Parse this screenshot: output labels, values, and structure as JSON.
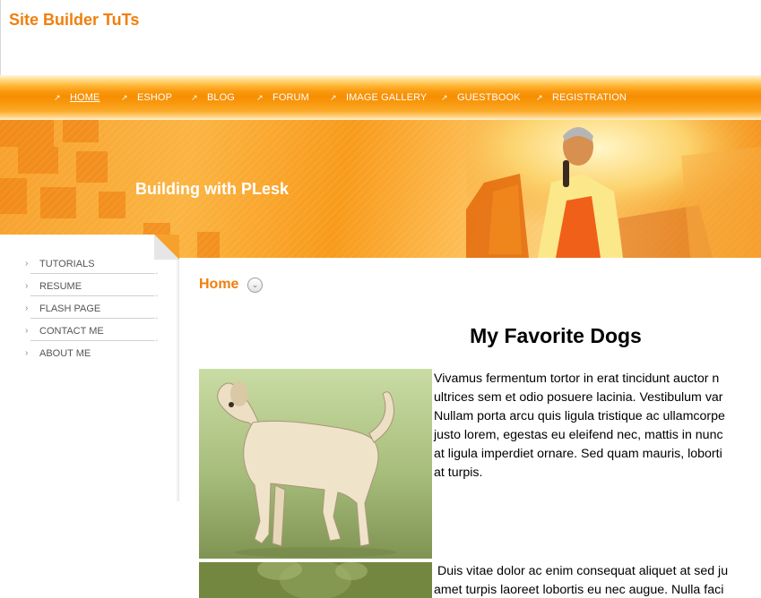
{
  "header": {
    "site_title": "Site Builder TuTs"
  },
  "nav": [
    {
      "label": "HOME",
      "active": true
    },
    {
      "label": "ESHOP"
    },
    {
      "label": "BLOG"
    },
    {
      "label": "FORUM"
    },
    {
      "label": "IMAGE GALLERY"
    },
    {
      "label": "GUESTBOOK"
    },
    {
      "label": "REGISTRATION"
    }
  ],
  "banner": {
    "title": "Building with PLesk"
  },
  "sidebar": {
    "items": [
      {
        "label": "TUTORIALS"
      },
      {
        "label": "RESUME"
      },
      {
        "label": "FLASH PAGE"
      },
      {
        "label": "CONTACT ME"
      },
      {
        "label": "ABOUT ME"
      }
    ]
  },
  "breadcrumb": {
    "label": "Home"
  },
  "article": {
    "title": "My Favorite Dogs",
    "paragraph1": [
      "Vivamus fermentum tortor in erat tincidunt auctor n",
      "ultrices sem et odio posuere lacinia. Vestibulum var",
      "Nullam porta arcu quis ligula tristique ac ullamcorpe",
      "justo lorem, egestas eu eleifend nec, mattis in nunc",
      "at ligula imperdiet ornare. Sed quam mauris, loborti",
      "at turpis."
    ],
    "paragraph2": [
      " Duis vitae dolor ac enim consequat aliquet at sed ju",
      "amet turpis laoreet lobortis eu nec augue. Nulla faci"
    ]
  },
  "colors": {
    "accent": "#f07f0c",
    "nav_orange": "#f78d00"
  }
}
